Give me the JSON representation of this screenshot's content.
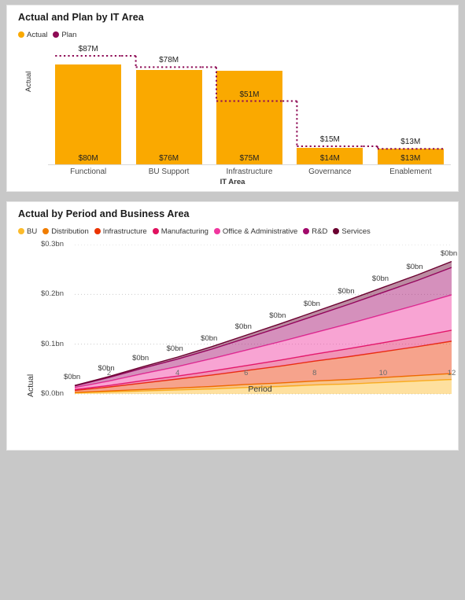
{
  "bar_panel": {
    "title": "Actual and Plan by IT Area",
    "legend": [
      {
        "label": "Actual",
        "color": "#FAA900"
      },
      {
        "label": "Plan",
        "color": "#8E0B55"
      }
    ],
    "y_axis_title": "Actual",
    "x_axis_title": "IT Area"
  },
  "area_panel": {
    "title": "Actual by Period and Business Area",
    "legend": [
      {
        "label": "BU",
        "color": "#FCBB2B"
      },
      {
        "label": "Distribution",
        "color": "#F07D00"
      },
      {
        "label": "Infrastructure",
        "color": "#EB3300"
      },
      {
        "label": "Manufacturing",
        "color": "#E0115F"
      },
      {
        "label": "Office & Administrative",
        "color": "#F0369E"
      },
      {
        "label": "R&D",
        "color": "#A1096B"
      },
      {
        "label": "Services",
        "color": "#6B0030"
      }
    ],
    "y_axis_title": "Actual",
    "x_axis_title": "Period"
  },
  "chart_data": [
    {
      "type": "bar",
      "title": "Actual and Plan by IT Area",
      "xlabel": "IT Area",
      "ylabel": "Actual",
      "categories": [
        "Functional",
        "BU Support",
        "Infrastructure",
        "Governance",
        "Enablement"
      ],
      "series": [
        {
          "name": "Actual",
          "values": [
            80,
            76,
            75,
            14,
            13
          ],
          "labels": [
            "$80M",
            "$76M",
            "$75M",
            "$14M",
            "$13M"
          ],
          "color": "#FAA900"
        },
        {
          "name": "Plan",
          "values": [
            87,
            78,
            51,
            15,
            13
          ],
          "labels": [
            "$87M",
            "$78M",
            "$51M",
            "$15M",
            "$13M"
          ],
          "color": "#8E0B55",
          "style": "dotted-step-line"
        }
      ],
      "ylim": [
        0,
        92
      ],
      "grid": false,
      "legend": "top-left"
    },
    {
      "type": "area",
      "stacked": true,
      "title": "Actual by Period and Business Area",
      "xlabel": "Period",
      "ylabel": "Actual",
      "x": [
        1,
        2,
        3,
        4,
        5,
        6,
        7,
        8,
        9,
        10,
        11,
        12
      ],
      "xticks": [
        "2",
        "4",
        "6",
        "8",
        "10",
        "12"
      ],
      "yticks": [
        "$0.0bn",
        "$0.1bn",
        "$0.2bn",
        "$0.3bn"
      ],
      "ylim": [
        0,
        0.3
      ],
      "xlim": [
        1,
        12
      ],
      "grid": true,
      "legend": "top-left",
      "data_labels": [
        "$0bn",
        "$0bn",
        "$0bn",
        "$0bn",
        "$0bn",
        "$0bn",
        "$0bn",
        "$0bn",
        "$0bn",
        "$0bn",
        "$0bn",
        "$0bn"
      ],
      "series": [
        {
          "name": "BU",
          "color": "#FCBB2B",
          "values": [
            0.002,
            0.004,
            0.006,
            0.008,
            0.01,
            0.013,
            0.015,
            0.018,
            0.02,
            0.023,
            0.026,
            0.029
          ]
        },
        {
          "name": "Distribution",
          "color": "#F07D00",
          "values": [
            0.001,
            0.002,
            0.003,
            0.004,
            0.005,
            0.006,
            0.007,
            0.008,
            0.009,
            0.01,
            0.011,
            0.012
          ]
        },
        {
          "name": "Infrastructure",
          "color": "#EB3300",
          "values": [
            0.004,
            0.008,
            0.013,
            0.018,
            0.023,
            0.028,
            0.034,
            0.04,
            0.046,
            0.052,
            0.058,
            0.065
          ]
        },
        {
          "name": "Manufacturing",
          "color": "#E0115F",
          "values": [
            0.002,
            0.003,
            0.005,
            0.006,
            0.008,
            0.01,
            0.012,
            0.014,
            0.016,
            0.018,
            0.02,
            0.022
          ]
        },
        {
          "name": "Office & Administrative",
          "color": "#F0369E",
          "values": [
            0.004,
            0.009,
            0.014,
            0.019,
            0.025,
            0.031,
            0.037,
            0.043,
            0.05,
            0.057,
            0.064,
            0.071
          ]
        },
        {
          "name": "R&D",
          "color": "#A1096B",
          "values": [
            0.003,
            0.007,
            0.011,
            0.015,
            0.019,
            0.024,
            0.029,
            0.034,
            0.039,
            0.044,
            0.049,
            0.055
          ]
        },
        {
          "name": "Services",
          "color": "#6B0030",
          "values": [
            0.001,
            0.002,
            0.003,
            0.004,
            0.005,
            0.006,
            0.007,
            0.008,
            0.009,
            0.01,
            0.011,
            0.012
          ]
        }
      ]
    }
  ]
}
